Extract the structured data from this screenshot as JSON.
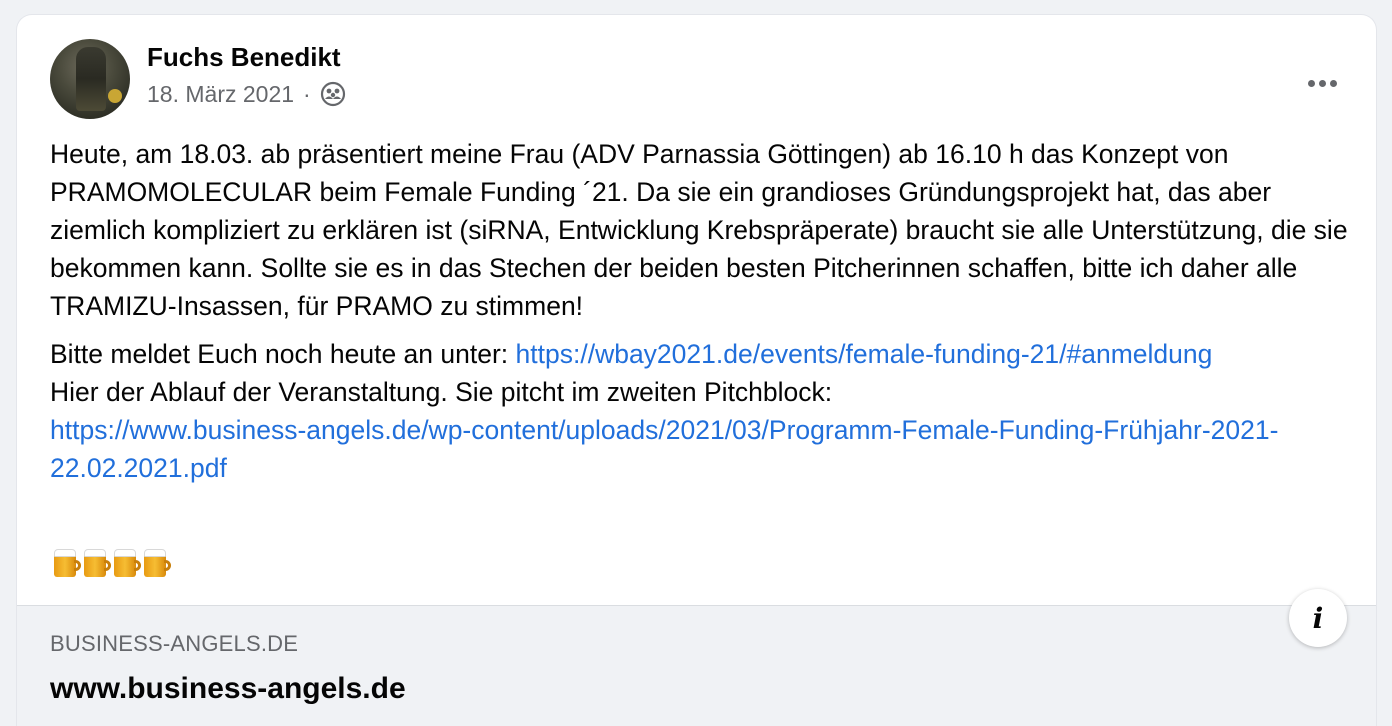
{
  "post": {
    "author": "Fuchs Benedikt",
    "date": "18. März 2021",
    "separator": "·",
    "audience_icon": "friends-icon",
    "more_icon": "more-options-icon",
    "paragraph1": "Heute, am 18.03. ab präsentiert meine Frau (ADV Parnassia Göttingen) ab 16.10 h das Konzept von PRAMOMOLECULAR beim Female Funding ´21. Da sie ein grandioses Gründungsprojekt hat, das aber ziemlich kompliziert zu erklären ist (siRNA, Entwicklung Krebspräperate) braucht sie alle Unterstützung, die sie bekommen kann. Sollte sie es in das Stechen der beiden besten Pitcherinnen schaffen, bitte ich daher alle TRAMIZU-Insassen, für PRAMO zu stimmen!",
    "line2_text": "Bitte meldet Euch noch heute an unter: ",
    "line2_link": "https://wbay2021.de/events/female-funding-21/#anmeldung",
    "line3_text": "Hier der Ablauf der Veranstaltung. Sie pitcht im zweiten Pitchblock:",
    "line4_link": "https://www.business-angels.de/wp-content/uploads/2021/03/Programm-Female-Funding-Frühjahr-2021-22.02.2021.pdf",
    "emoji_icon": "beer-mug-icon",
    "emoji_count": 4
  },
  "link_preview": {
    "domain": "BUSINESS-ANGELS.DE",
    "title": "www.business-angels.de",
    "info_label": "i"
  },
  "colors": {
    "link": "#216fdb",
    "secondary_text": "#65676b",
    "preview_bg": "#f0f2f5"
  }
}
